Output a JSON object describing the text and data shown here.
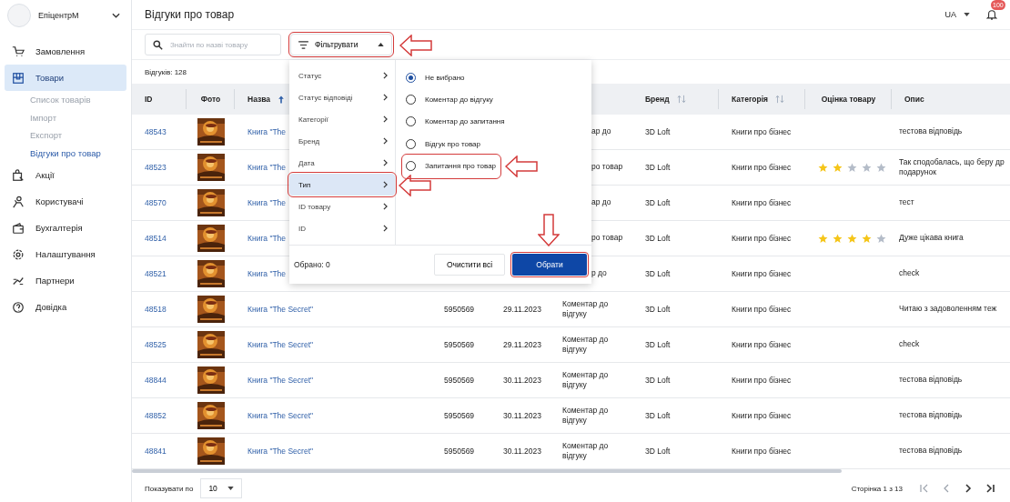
{
  "sidebar": {
    "brand": "ЕпіцентрМ",
    "items": [
      {
        "label": "Замовлення",
        "selected": false
      },
      {
        "label": "Товари",
        "selected": true,
        "children": [
          {
            "label": "Список товарів",
            "selected": false
          },
          {
            "label": "Імпорт",
            "selected": false
          },
          {
            "label": "Експорт",
            "selected": false
          },
          {
            "label": "Відгуки про товар",
            "selected": true
          }
        ]
      },
      {
        "label": "Акції",
        "selected": false
      },
      {
        "label": "Користувачі",
        "selected": false
      },
      {
        "label": "Бухгалтерія",
        "selected": false
      },
      {
        "label": "Налаштування",
        "selected": false
      },
      {
        "label": "Партнери",
        "selected": false
      },
      {
        "label": "Довідка",
        "selected": false
      }
    ]
  },
  "header": {
    "title": "Відгуки про товар",
    "language": "UA",
    "notifications": "100"
  },
  "toolbar": {
    "search": {
      "placeholder": "Знайти по назві товару"
    },
    "filter": {
      "label": "Фільтрувати",
      "expanded": true,
      "annotated": true
    }
  },
  "count": "Відгуків: 128",
  "table": {
    "columns": [
      {
        "label": "ID",
        "sortable": false
      },
      {
        "label": "Фото",
        "sortable": false
      },
      {
        "label": "Назва",
        "sortable": true,
        "sorted": true
      },
      {
        "label": "Бренд",
        "sortable": true,
        "sorted": false
      },
      {
        "label": "Категорія",
        "sortable": true,
        "sorted": false
      },
      {
        "label": "Оцінка товару",
        "sortable": false
      },
      {
        "label": "Опис",
        "sortable": false
      }
    ],
    "rows": [
      {
        "id": "48543",
        "name": "Книга \"The",
        "covered": true,
        "type": "ар до",
        "brand": "3D Loft",
        "category": "Книги про бізнес",
        "description": "тестова відповідь"
      },
      {
        "id": "48523",
        "name": "Книга \"The",
        "covered": true,
        "type": "ро товар",
        "brand": "3D Loft",
        "category": "Книги про бізнес",
        "stars": 2,
        "description": "Так сподобалась, що беру др подарунок"
      },
      {
        "id": "48570",
        "name": "Книга \"The",
        "covered": true,
        "type": "ар до",
        "brand": "3D Loft",
        "category": "Книги про бізнес",
        "description": "тест"
      },
      {
        "id": "48514",
        "name": "Книга \"The",
        "covered": true,
        "type": "ро товар",
        "brand": "3D Loft",
        "category": "Книги про бізнес",
        "stars": 4,
        "description": "Дуже цікава книга"
      },
      {
        "id": "48521",
        "name": "Книга \"The",
        "covered": true,
        "type": "р до",
        "brand": "3D Loft",
        "category": "Книги про бізнес",
        "description": "check"
      },
      {
        "id": "48518",
        "name": "Книга \"The Secret\"",
        "covered": false,
        "product_id": "5950569",
        "date": "29.11.2023",
        "type": "Коментар до відгуку",
        "brand": "3D Loft",
        "category": "Книги про бізнес",
        "description": "Читаю з задоволенням теж"
      },
      {
        "id": "48525",
        "name": "Книга \"The Secret\"",
        "covered": false,
        "product_id": "5950569",
        "date": "29.11.2023",
        "type": "Коментар до відгуку",
        "brand": "3D Loft",
        "category": "Книги про бізнес",
        "description": "check"
      },
      {
        "id": "48844",
        "name": "Книга \"The Secret\"",
        "covered": false,
        "product_id": "5950569",
        "date": "30.11.2023",
        "type": "Коментар до відгуку",
        "brand": "3D Loft",
        "category": "Книги про бізнес",
        "description": "тестова відповідь"
      },
      {
        "id": "48852",
        "name": "Книга \"The Secret\"",
        "covered": false,
        "product_id": "5950569",
        "date": "30.11.2023",
        "type": "Коментар до відгуку",
        "brand": "3D Loft",
        "category": "Книги про бізнес",
        "description": "тестова відповідь"
      },
      {
        "id": "48841",
        "name": "Книга \"The Secret\"",
        "covered": false,
        "product_id": "5950569",
        "date": "30.11.2023",
        "type": "Коментар до відгуку",
        "brand": "3D Loft",
        "category": "Книги про бізнес",
        "description": "тестова відповідь"
      }
    ]
  },
  "filter_menu": {
    "categories": [
      {
        "label": "Статус",
        "selected": false
      },
      {
        "label": "Статус відповіді",
        "selected": false
      },
      {
        "label": "Категорії",
        "selected": false
      },
      {
        "label": "Бренд",
        "selected": false
      },
      {
        "label": "Дата",
        "selected": false
      },
      {
        "label": "Тип",
        "selected": true,
        "annotated": true
      },
      {
        "label": "ID товару",
        "selected": false
      },
      {
        "label": "ID",
        "selected": false
      }
    ],
    "options": [
      {
        "label": "Не вибрано",
        "selected": true
      },
      {
        "label": "Коментар до відгуку",
        "selected": false
      },
      {
        "label": "Коментар до запитання",
        "selected": false
      },
      {
        "label": "Відгук про товар",
        "selected": false
      },
      {
        "label": "Запитання про товар",
        "selected": false,
        "annotated": true
      }
    ],
    "selected_count": "Обрано: 0",
    "buttons": [
      {
        "label": "Очистити всі",
        "kind": "secondary"
      },
      {
        "label": "Обрати",
        "kind": "primary",
        "annotated": true
      }
    ]
  },
  "footer": {
    "page_size_label": "Показувати по",
    "page_size": "10",
    "page_info": "Сторінка 1 з 13"
  }
}
